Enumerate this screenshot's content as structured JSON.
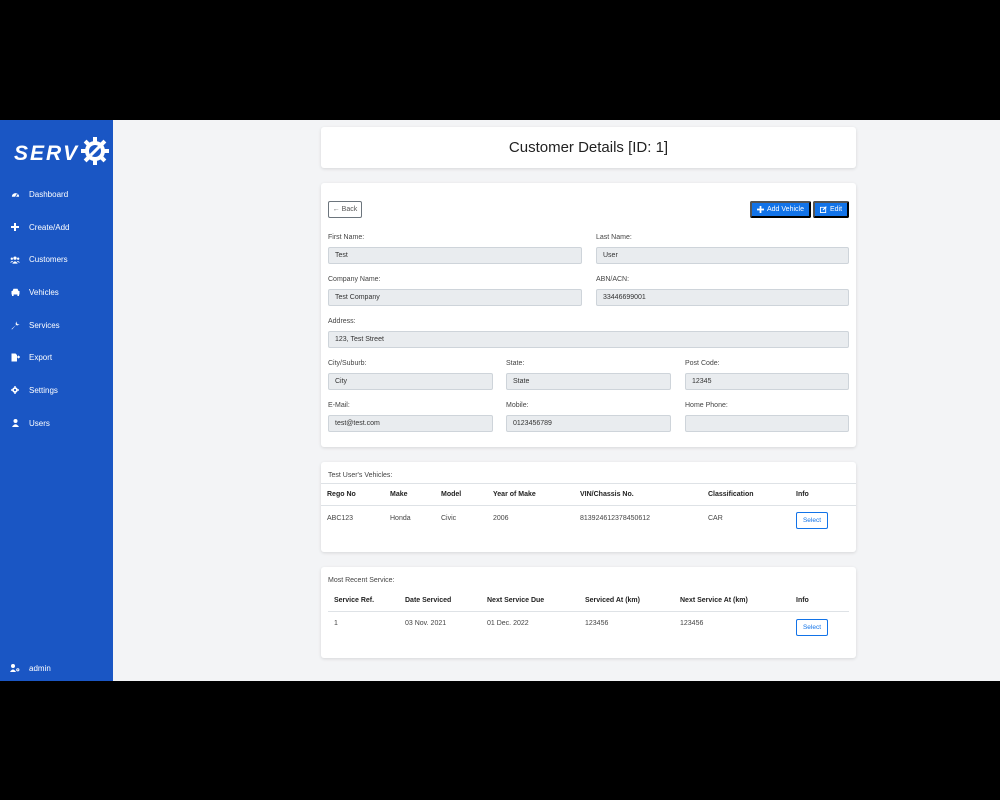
{
  "app": {
    "name": "SERV"
  },
  "sidebar": {
    "items": [
      {
        "label": "Dashboard",
        "icon": "dashboard-icon"
      },
      {
        "label": "Create/Add",
        "icon": "plus-icon"
      },
      {
        "label": "Customers",
        "icon": "users-icon"
      },
      {
        "label": "Vehicles",
        "icon": "car-icon"
      },
      {
        "label": "Services",
        "icon": "wrench-icon"
      },
      {
        "label": "Export",
        "icon": "export-icon"
      },
      {
        "label": "Settings",
        "icon": "gear-icon"
      },
      {
        "label": "Users",
        "icon": "user-icon"
      }
    ],
    "user": {
      "label": "admin",
      "icon": "user-cog-icon"
    }
  },
  "page": {
    "title": "Customer Details [ID: 1]"
  },
  "toolbar": {
    "back_label": "← Back",
    "add_vehicle_label": "Add Vehicle",
    "edit_label": "Edit"
  },
  "form": {
    "first_name": {
      "label": "First Name:",
      "value": "Test"
    },
    "last_name": {
      "label": "Last Name:",
      "value": "User"
    },
    "company_name": {
      "label": "Company Name:",
      "value": "Test Company"
    },
    "abn": {
      "label": "ABN/ACN:",
      "value": "33446699001"
    },
    "address": {
      "label": "Address:",
      "value": "123, Test Street"
    },
    "city": {
      "label": "City/Suburb:",
      "value": "City"
    },
    "state": {
      "label": "State:",
      "value": "State"
    },
    "post_code": {
      "label": "Post Code:",
      "value": "12345"
    },
    "email": {
      "label": "E-Mail:",
      "value": "test@test.com"
    },
    "mobile": {
      "label": "Mobile:",
      "value": "0123456789"
    },
    "home_phone": {
      "label": "Home Phone:",
      "value": ""
    }
  },
  "vehicles": {
    "caption": "Test User's Vehicles:",
    "headers": [
      "Rego No",
      "Make",
      "Model",
      "Year of Make",
      "VIN/Chassis No.",
      "Classification",
      "Info"
    ],
    "rows": [
      {
        "rego": "ABC123",
        "make": "Honda",
        "model": "Civic",
        "year": "2006",
        "vin": "813924612378450612",
        "classification": "CAR",
        "action": "Select"
      }
    ]
  },
  "services": {
    "caption": "Most Recent Service:",
    "headers": [
      "Service Ref.",
      "Date Serviced",
      "Next Service Due",
      "Serviced At (km)",
      "Next Service At (km)",
      "Info"
    ],
    "rows": [
      {
        "ref": "1",
        "date": "03 Nov. 2021",
        "next_due": "01 Dec. 2022",
        "serviced_at": "123456",
        "next_at": "123456",
        "action": "Select"
      }
    ]
  },
  "colors": {
    "sidebar": "#1a56c4",
    "primary": "#1273e8",
    "background": "#f3f4f6"
  }
}
